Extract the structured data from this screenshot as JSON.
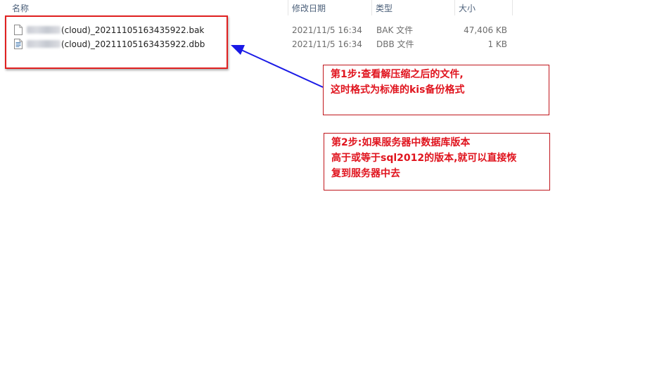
{
  "columns": {
    "name": "名称",
    "date_modified": "修改日期",
    "type": "类型",
    "size": "大小"
  },
  "files": [
    {
      "name_suffix": "(cloud)_20211105163435922.bak",
      "date_modified": "2021/11/5 16:34",
      "type": "BAK 文件",
      "size": "47,406 KB",
      "icon": "blank-file-icon"
    },
    {
      "name_suffix": "(cloud)_20211105163435922.dbb",
      "date_modified": "2021/11/5 16:34",
      "type": "DBB 文件",
      "size": "1 KB",
      "icon": "text-file-icon"
    }
  ],
  "annotations": {
    "step1": "第1步:查看解压缩之后的文件,\n这时格式为标准的kis备份格式",
    "step2": "第2步:如果服务器中数据库版本\n高于或等于sql2012的版本,就可以直接恢\n复到服务器中去"
  },
  "colors": {
    "annotation_red": "#e0141e",
    "box_border_red": "#e02020",
    "arrow_blue": "#1a1ae6",
    "header_text": "#4c607a"
  }
}
